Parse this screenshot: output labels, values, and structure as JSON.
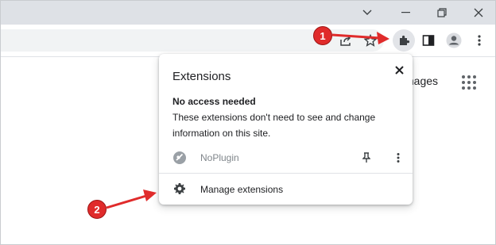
{
  "window": {
    "minimize_icon": "chevron-down",
    "controls": [
      "minimize",
      "restore",
      "close"
    ]
  },
  "toolbar": {
    "icons": [
      "share-icon",
      "star-icon",
      "extensions-puzzle-icon",
      "side-panel-icon",
      "profile-icon",
      "kebab-menu-icon"
    ]
  },
  "page": {
    "images_link": "mages",
    "apps_icon": "apps-grid-icon"
  },
  "popup": {
    "title": "Extensions",
    "section_heading": "No access needed",
    "section_description": "These extensions don't need to see and change information on this site.",
    "extension": {
      "name": "NoPlugin",
      "icon": "noplugin-icon"
    },
    "manage_label": "Manage extensions"
  },
  "annotations": {
    "marker_1": "1",
    "marker_2": "2",
    "color": "#e02b2b"
  }
}
